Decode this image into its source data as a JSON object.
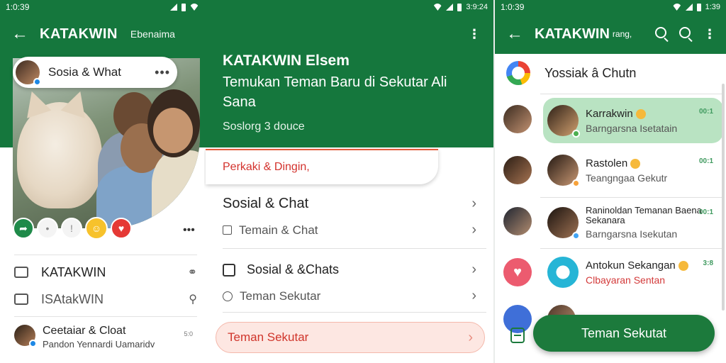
{
  "panel1": {
    "status": {
      "time": "1:0:39"
    },
    "header": {
      "title": "KATAKWIN",
      "subtitle": "Ebenaima"
    },
    "pill": {
      "name": "Sosia & What"
    },
    "list": [
      {
        "label": "KATAKWIN"
      },
      {
        "label": "ISAtakWIN"
      }
    ],
    "chat": {
      "name": "Ceetaiar & Cloat",
      "preview": "Pandon Yennardi Uamaridv",
      "time": "5:0"
    }
  },
  "panel2": {
    "status": {
      "time": "3:9:24"
    },
    "header": {
      "title": "KATAKWIN Elsem",
      "subtitle": "Temukan Teman Baru di Sekutar Ali Sana",
      "small": "Soslorg 3 douce"
    },
    "search_placeholder": "Perkaki & Dingin,",
    "menu": [
      {
        "label": "Sosial & Chat"
      },
      {
        "label": "Temain & Chat"
      },
      {
        "label": "Sosial & &Chats"
      },
      {
        "label": "Teman Sekutar"
      }
    ],
    "cta": {
      "label": "Teman Sekutar"
    }
  },
  "panel3": {
    "status": {
      "time": "1:0:39",
      "right_time": "1:39"
    },
    "header": {
      "title": "KATAKWIN",
      "subtitle": "rang,"
    },
    "top_item": {
      "label": "Yossiak â Chutn"
    },
    "chats": [
      {
        "name": "Karrakwin",
        "preview": "Barngarsna Isetatain",
        "time": "00:1"
      },
      {
        "name": "Rastolen",
        "preview": "Teangngaa Gekutr",
        "time": "00:1"
      },
      {
        "name": "Raninoldan Temanan Baena Sekanara",
        "preview": "Barngarsna Isekutan",
        "time": "00:1"
      },
      {
        "name": "Antokun Sekangan",
        "preview": "Clbayaran Sentan",
        "time": "3:8"
      }
    ],
    "fab": {
      "label": "Teman Sekutat"
    }
  },
  "colors": {
    "brand_green": "#15773d",
    "active_card": "#b9e3c2",
    "cta_red": "#d0352b"
  }
}
